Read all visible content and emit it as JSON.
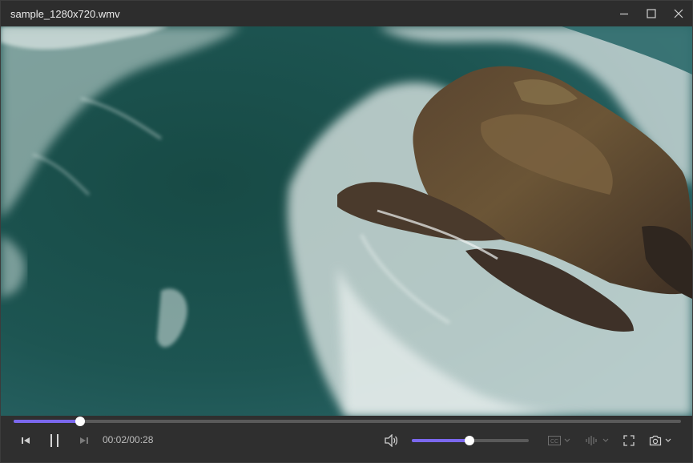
{
  "window": {
    "title": "sample_1280x720.wmv"
  },
  "icons": {
    "minimize": "minimize-icon",
    "maximize": "maximize-icon",
    "close": "close-icon",
    "previous": "skip-previous-icon",
    "pause": "pause-icon",
    "next": "skip-next-icon",
    "volume": "volume-icon",
    "subtitles": "cc-icon",
    "audio_track": "audio-track-icon",
    "fullscreen": "fullscreen-icon",
    "snapshot": "camera-icon"
  },
  "player": {
    "current_time": "00:02",
    "duration": "00:28",
    "time_display": "00:02/00:28",
    "progress": 0.1,
    "volume": 0.49
  },
  "colors": {
    "accent": "#7b68ee",
    "titlebar": "#2d2d2d",
    "controls_bg": "#2f2f2f"
  }
}
